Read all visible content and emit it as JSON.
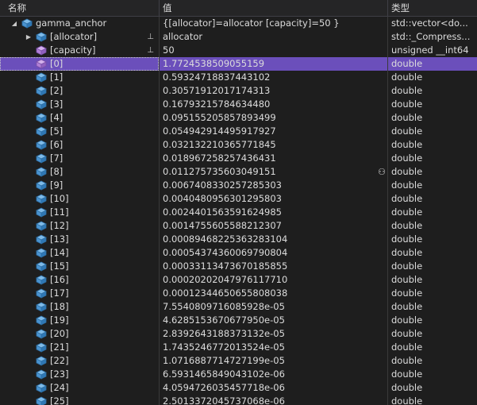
{
  "columns": {
    "name": "名称",
    "value": "值",
    "type": "类型"
  },
  "root": {
    "name": "gamma_anchor",
    "value": "{[allocator]=allocator [capacity]=50 }",
    "type": "std::vector<do..."
  },
  "children": [
    {
      "name": "[allocator]",
      "value": "allocator",
      "type": "std::_Compress...",
      "icon": "blue-cube-icon",
      "expandable": true,
      "pinned": true
    },
    {
      "name": "[capacity]",
      "value": "50",
      "type": "unsigned __int64",
      "icon": "purple-cube-icon",
      "expandable": false,
      "pinned": true
    }
  ],
  "elements": [
    {
      "name": "[0]",
      "value": "1.7724538509055159",
      "type": "double"
    },
    {
      "name": "[1]",
      "value": "0.59324718837443102",
      "type": "double"
    },
    {
      "name": "[2]",
      "value": "0.30571912017174313",
      "type": "double"
    },
    {
      "name": "[3]",
      "value": "0.16793215784634480",
      "type": "double"
    },
    {
      "name": "[4]",
      "value": "0.095155205857893499",
      "type": "double"
    },
    {
      "name": "[5]",
      "value": "0.054942914495917927",
      "type": "double"
    },
    {
      "name": "[6]",
      "value": "0.032132210365771845",
      "type": "double"
    },
    {
      "name": "[7]",
      "value": "0.018967258257436431",
      "type": "double"
    },
    {
      "name": "[8]",
      "value": "0.011275735603049151",
      "type": "double"
    },
    {
      "name": "[9]",
      "value": "0.0067408330257285303",
      "type": "double"
    },
    {
      "name": "[10]",
      "value": "0.0040480956301295803",
      "type": "double"
    },
    {
      "name": "[11]",
      "value": "0.0024401563591624985",
      "type": "double"
    },
    {
      "name": "[12]",
      "value": "0.0014755605588212307",
      "type": "double"
    },
    {
      "name": "[13]",
      "value": "0.00089468225363283104",
      "type": "double"
    },
    {
      "name": "[14]",
      "value": "0.00054374360069790804",
      "type": "double"
    },
    {
      "name": "[15]",
      "value": "0.00033113473670185855",
      "type": "double"
    },
    {
      "name": "[16]",
      "value": "0.00020202047976117710",
      "type": "double"
    },
    {
      "name": "[17]",
      "value": "0.00012344650655808038",
      "type": "double"
    },
    {
      "name": "[18]",
      "value": "7.5540809716085928e-05",
      "type": "double"
    },
    {
      "name": "[19]",
      "value": "4.6285153670677950e-05",
      "type": "double"
    },
    {
      "name": "[20]",
      "value": "2.8392643188373132e-05",
      "type": "double"
    },
    {
      "name": "[21]",
      "value": "1.7435246772013524e-05",
      "type": "double"
    },
    {
      "name": "[22]",
      "value": "1.0716887714727199e-05",
      "type": "double"
    },
    {
      "name": "[23]",
      "value": "6.5931465849043102e-06",
      "type": "double"
    },
    {
      "name": "[24]",
      "value": "4.0594726035457718e-06",
      "type": "double"
    },
    {
      "name": "[25]",
      "value": "2.5013372045737068e-06",
      "type": "double"
    }
  ],
  "selected_index": 0,
  "colors": {
    "selection": "#6b4fbb",
    "background": "#1e1e1e",
    "cube_blue": "#5fa8e0",
    "cube_purple": "#b180d7"
  }
}
